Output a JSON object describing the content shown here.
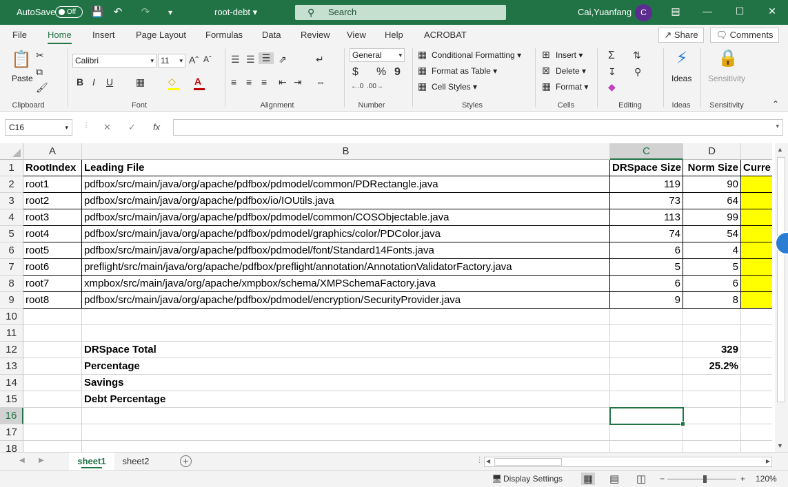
{
  "titlebar": {
    "autosave_label": "AutoSave",
    "autosave_state": "Off",
    "doc_title": "root-debt",
    "search_placeholder": "Search",
    "user_name": "Cai,Yuanfang",
    "avatar_letter": "C",
    "accent": "#217346"
  },
  "menu": {
    "tabs": [
      "File",
      "Home",
      "Insert",
      "Page Layout",
      "Formulas",
      "Data",
      "Review",
      "View",
      "Help",
      "ACROBAT"
    ],
    "active": "Home",
    "share": "Share",
    "comments": "Comments"
  },
  "ribbon": {
    "clipboard": {
      "paste": "Paste",
      "label": "Clipboard"
    },
    "font": {
      "name": "Calibri",
      "size": "11",
      "bold": "B",
      "italic": "I",
      "underline": "U",
      "label": "Font"
    },
    "alignment": {
      "label": "Alignment"
    },
    "number": {
      "format": "General",
      "currency": "$",
      "percent": "%",
      "comma": "9",
      "label": "Number"
    },
    "styles": {
      "conditional": "Conditional Formatting",
      "table": "Format as Table",
      "cell_styles": "Cell Styles",
      "label": "Styles"
    },
    "cells": {
      "insert": "Insert",
      "delete": "Delete",
      "format": "Format",
      "label": "Cells"
    },
    "editing": {
      "label": "Editing"
    },
    "ideas": {
      "button": "Ideas",
      "label": "Ideas"
    },
    "sensitivity": {
      "button": "Sensitivity",
      "label": "Sensitivity"
    }
  },
  "formula_bar": {
    "name_box": "C16",
    "fx": "fx",
    "formula": ""
  },
  "grid": {
    "columns": [
      "A",
      "B",
      "C",
      "D",
      "Curre"
    ],
    "selected_column": "C",
    "selected_row": "16",
    "rows": [
      {
        "n": "1",
        "a": "RootIndex",
        "b": "Leading File",
        "c": "DRSpace Size",
        "d": "Norm Size",
        "e": "Curre"
      },
      {
        "n": "2",
        "a": "root1",
        "b": "pdfbox/src/main/java/org/apache/pdfbox/pdmodel/common/PDRectangle.java",
        "c": "119",
        "d": "90"
      },
      {
        "n": "3",
        "a": "root2",
        "b": "pdfbox/src/main/java/org/apache/pdfbox/io/IOUtils.java",
        "c": "73",
        "d": "64"
      },
      {
        "n": "4",
        "a": "root3",
        "b": "pdfbox/src/main/java/org/apache/pdfbox/pdmodel/common/COSObjectable.java",
        "c": "113",
        "d": "99"
      },
      {
        "n": "5",
        "a": "root4",
        "b": "pdfbox/src/main/java/org/apache/pdfbox/pdmodel/graphics/color/PDColor.java",
        "c": "74",
        "d": "54"
      },
      {
        "n": "6",
        "a": "root5",
        "b": "pdfbox/src/main/java/org/apache/pdfbox/pdmodel/font/Standard14Fonts.java",
        "c": "6",
        "d": "4"
      },
      {
        "n": "7",
        "a": "root6",
        "b": "preflight/src/main/java/org/apache/pdfbox/preflight/annotation/AnnotationValidatorFactory.java",
        "c": "5",
        "d": "5"
      },
      {
        "n": "8",
        "a": "root7",
        "b": "xmpbox/src/main/java/org/apache/xmpbox/schema/XMPSchemaFactory.java",
        "c": "6",
        "d": "6"
      },
      {
        "n": "9",
        "a": "root8",
        "b": "pdfbox/src/main/java/org/apache/pdfbox/pdmodel/encryption/SecurityProvider.java",
        "c": "9",
        "d": "8"
      },
      {
        "n": "10"
      },
      {
        "n": "11"
      },
      {
        "n": "12",
        "b": "DRSpace Total",
        "d": "329"
      },
      {
        "n": "13",
        "b": "Percentage",
        "d": "25.2%"
      },
      {
        "n": "14",
        "b": "Savings"
      },
      {
        "n": "15",
        "b": "Debt Percentage"
      },
      {
        "n": "16"
      },
      {
        "n": "17"
      },
      {
        "n": "18"
      }
    ],
    "highlight_color": "#ffff00"
  },
  "sheets": {
    "tabs": [
      "sheet1",
      "sheet2"
    ],
    "active": "sheet1"
  },
  "statusbar": {
    "display_settings": "Display Settings",
    "zoom": "120%"
  }
}
